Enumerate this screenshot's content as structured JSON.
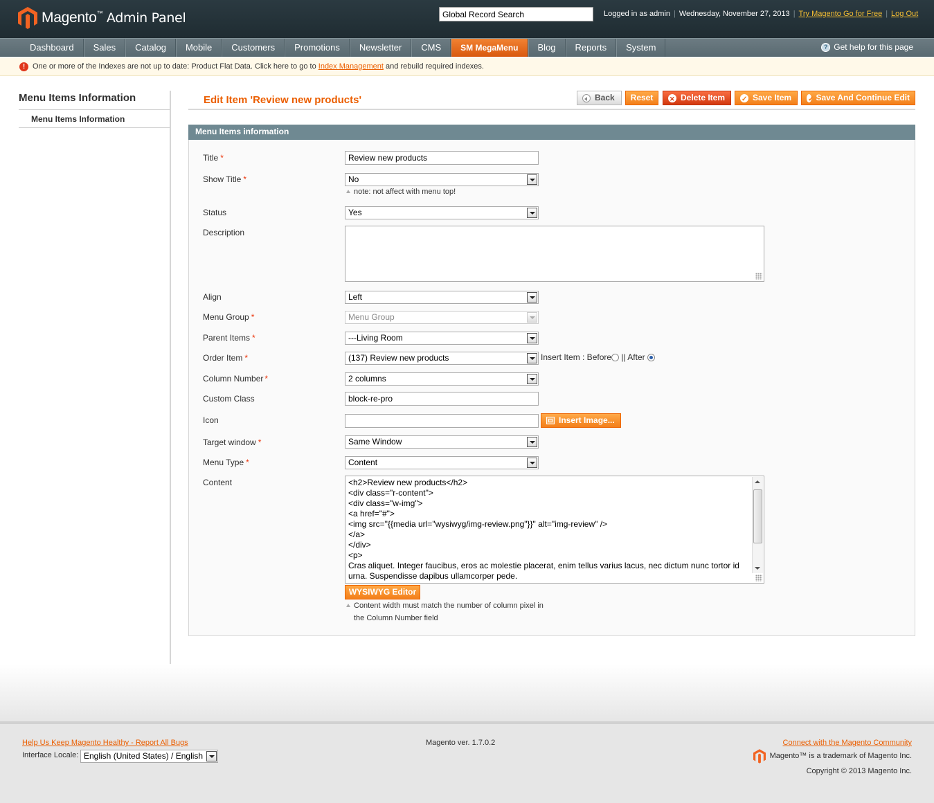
{
  "header": {
    "logo_brand": "Magento",
    "logo_tm": "™",
    "logo_sub": "Admin Panel",
    "search_value": "Global Record Search",
    "logged_in": "Logged in as admin",
    "date": "Wednesday, November 27, 2013",
    "try_link": "Try Magento Go for Free",
    "logout": "Log Out",
    "sep": "|"
  },
  "nav": {
    "items": [
      "Dashboard",
      "Sales",
      "Catalog",
      "Mobile",
      "Customers",
      "Promotions",
      "Newsletter",
      "CMS",
      "SM MegaMenu",
      "Blog",
      "Reports",
      "System"
    ],
    "active_index": 8,
    "help": "Get help for this page"
  },
  "notice": {
    "bold": "One or more of the Indexes are not up to date:",
    "text": "Product Flat Data. Click here to go to",
    "link": "Index Management",
    "after": "and rebuild required indexes."
  },
  "sidebar": {
    "title": "Menu Items Information",
    "item": "Menu Items Information"
  },
  "page": {
    "title": "Edit Item 'Review new products'",
    "buttons": {
      "back": "Back",
      "reset": "Reset",
      "delete": "Delete Item",
      "save": "Save Item",
      "save_continue": "Save And Continue Edit"
    }
  },
  "form": {
    "legend": "Menu Items information",
    "required_mark": "*",
    "title": {
      "label": "Title",
      "value": "Review new products"
    },
    "show_title": {
      "label": "Show Title",
      "value": "No",
      "note": "note: not affect with menu top!"
    },
    "status": {
      "label": "Status",
      "value": "Yes"
    },
    "description": {
      "label": "Description",
      "value": ""
    },
    "align": {
      "label": "Align",
      "value": "Left"
    },
    "menu_group": {
      "label": "Menu Group",
      "value": "Menu Group"
    },
    "parent_items": {
      "label": "Parent Items",
      "value": "---Living Room"
    },
    "order_item": {
      "label": "Order Item",
      "value": "(137) Review new products",
      "insert_label": "Insert Item : Before",
      "after_label": "|| After",
      "selected": "after"
    },
    "column_number": {
      "label": "Column Number",
      "value": "2 columns"
    },
    "custom_class": {
      "label": "Custom Class",
      "value": "block-re-pro"
    },
    "icon": {
      "label": "Icon",
      "value": "",
      "button": "Insert Image..."
    },
    "target_window": {
      "label": "Target window",
      "value": "Same Window"
    },
    "menu_type": {
      "label": "Menu Type",
      "value": "Content"
    },
    "content": {
      "label": "Content",
      "value": "<h2>Review new products</h2>\n<div class=\"r-content\">\n<div class=\"w-img\">\n<a href=\"#\">\n<img src=\"{{media url=\"wysiwyg/img-review.png\"}}\" alt=\"img-review\" />\n</a>\n</div>\n<p>\nCras aliquet. Integer faucibus, eros ac molestie placerat, enim tellus varius lacus, nec dictum nunc tortor id urna. Suspendisse dapibus ullamcorper pede.",
      "editor_button": "WYSIWYG Editor",
      "note_line1": "Content width must match the number of column pixel in",
      "note_line2": "the Column Number field"
    }
  },
  "footer": {
    "bug_link": "Help Us Keep Magento Healthy - Report All Bugs",
    "locale_label": "Interface Locale:",
    "locale_value": "English (United States) / English",
    "version": "Magento ver. 1.7.0.2",
    "community_link": "Connect with the Magento Community",
    "trademark": "Magento™ is a trademark of Magento Inc.",
    "copyright": "Copyright © 2013 Magento Inc."
  },
  "colors": {
    "accent": "#eb5e00",
    "header_bg": "#2b3a41",
    "nav_bg": "#6c7b82",
    "fieldset_head": "#6f8992"
  }
}
